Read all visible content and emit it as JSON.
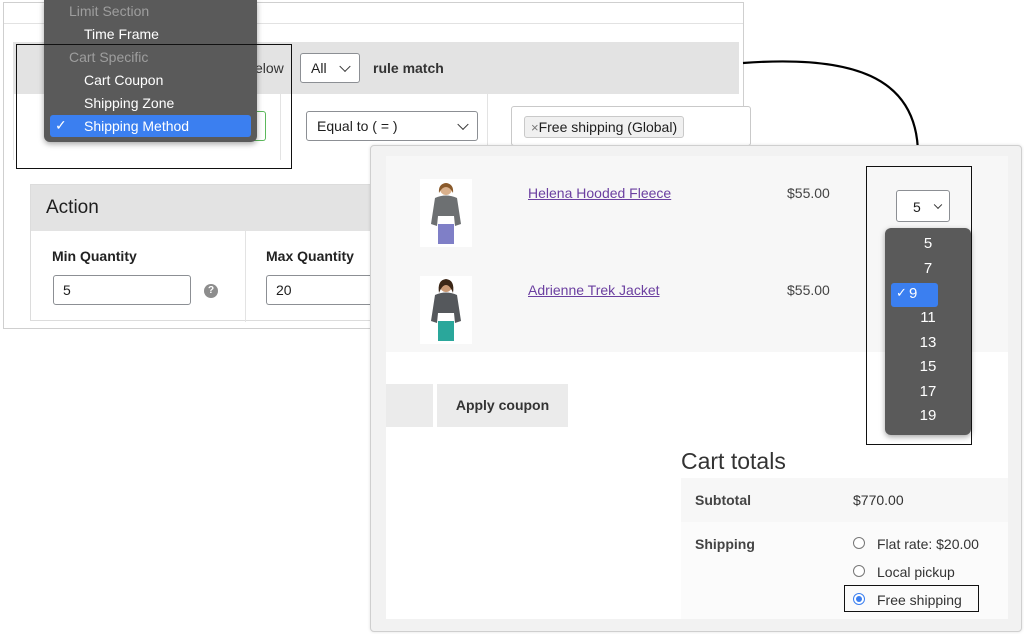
{
  "menu": {
    "group_limit": "Limit Section",
    "item_time_frame": "Time Frame",
    "group_cart": "Cart Specific",
    "item_cart_coupon": "Cart Coupon",
    "item_shipping_zone": "Shipping Zone",
    "item_shipping_method": "Shipping Method",
    "selected_check": "✓"
  },
  "rule": {
    "below_fragment": "elow",
    "match_value": "All",
    "rule_match_label": "rule match",
    "operator_value": "Equal to ( = )",
    "token_remove": "×",
    "token_label": "Free shipping (Global)"
  },
  "action": {
    "title": "Action",
    "min_label": "Min Quantity",
    "min_value": "5",
    "max_label": "Max Quantity",
    "max_value": "20",
    "help_icon_glyph": "?"
  },
  "cart": {
    "products": [
      {
        "name": "Helena Hooded Fleece",
        "price": "$55.00",
        "qty": "5"
      },
      {
        "name": "Adrienne Trek Jacket",
        "price": "$55.00"
      }
    ],
    "apply_coupon": "Apply coupon",
    "totals_title": "Cart totals",
    "subtotal_label": "Subtotal",
    "subtotal_value": "$770.00",
    "shipping_label": "Shipping",
    "shipping_options": [
      "Flat rate: $20.00",
      "Local pickup",
      "Free shipping"
    ],
    "shipping_selected": "Free shipping"
  },
  "qty_options": {
    "values": [
      "5",
      "7",
      "9",
      "11",
      "13",
      "15",
      "17",
      "19"
    ],
    "selected": "9",
    "check": "✓"
  },
  "colors": {
    "accent_blue": "#3b7ff0",
    "menu_bg": "#5a5a5a",
    "link_purple": "#6b3fa0",
    "header_gray": "#e3e3e3"
  }
}
